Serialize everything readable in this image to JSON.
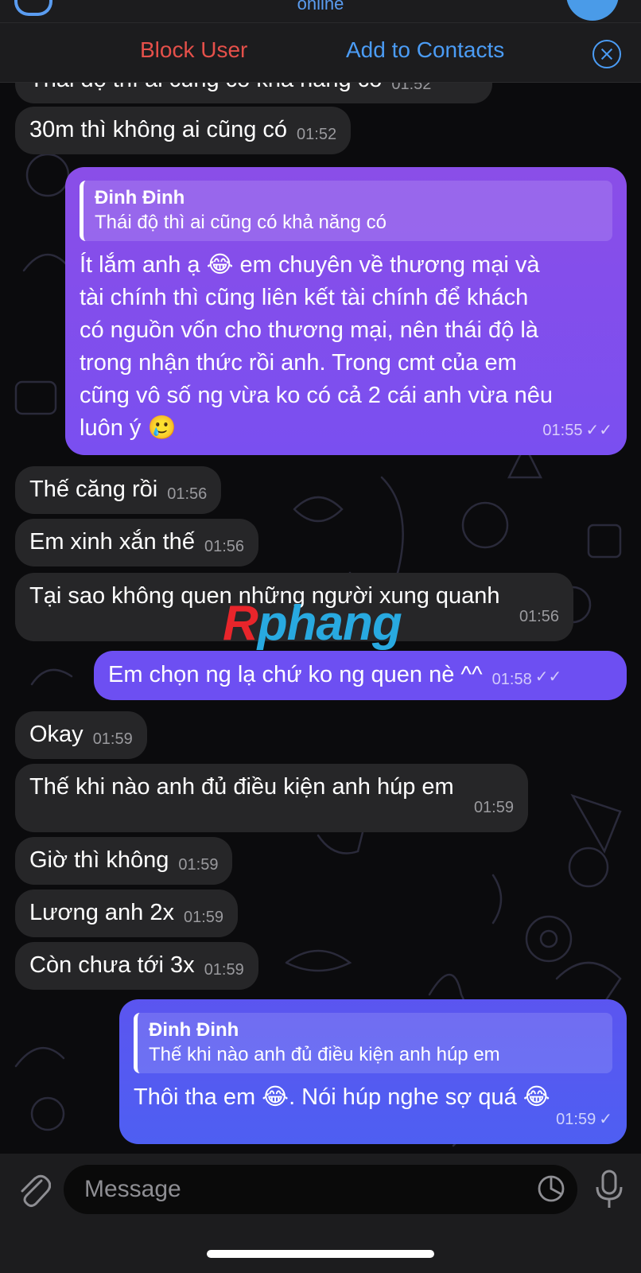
{
  "header": {
    "status": "online",
    "block_label": "Block User",
    "add_contacts_label": "Add to Contacts"
  },
  "messages": [
    {
      "dir": "in",
      "text": "Thái độ thì ai cũng có khả năng có",
      "time": "01:52"
    },
    {
      "dir": "in",
      "text": "30m thì không ai cũng có",
      "time": "01:52"
    },
    {
      "dir": "out",
      "reply_name": "Đinh Đinh",
      "reply_text": "Thái độ thì ai cũng có khả năng có",
      "lines": [
        "Ít lắm anh ạ 😂 em chuyên về thương mại và",
        "tài chính thì cũng liên kết tài chính để khách",
        "có nguồn vốn cho thương mại, nên thái độ là",
        "trong nhận thức rồi anh. Trong cmt của em",
        "cũng vô số ng vừa ko có cả 2 cái anh vừa nêu",
        "luôn ý 🥲"
      ],
      "time": "01:55",
      "status": "read"
    },
    {
      "dir": "in",
      "text": "Thế căng rồi",
      "time": "01:56"
    },
    {
      "dir": "in",
      "text": "Em xinh xắn thế",
      "time": "01:56"
    },
    {
      "dir": "in",
      "text": "Tại sao không quen những người xung quanh",
      "time": "01:56"
    },
    {
      "dir": "out",
      "text": "Em chọn ng lạ chứ ko ng quen nè ^^",
      "time": "01:58",
      "status": "read"
    },
    {
      "dir": "in",
      "text": "Okay",
      "time": "01:59"
    },
    {
      "dir": "in",
      "text": "Thế khi nào anh đủ điều kiện anh húp em",
      "time": "01:59"
    },
    {
      "dir": "in",
      "text": "Giờ thì không",
      "time": "01:59"
    },
    {
      "dir": "in",
      "text": "Lương anh 2x",
      "time": "01:59"
    },
    {
      "dir": "in",
      "text": "Còn chưa tới 3x",
      "time": "01:59"
    },
    {
      "dir": "out",
      "reply_name": "Đinh Đinh",
      "reply_text": "Thế khi nào anh đủ điều kiện anh húp em",
      "text": "Thôi tha em 😂. Nói húp nghe sợ quá 😂",
      "time": "01:59",
      "status": "sent"
    }
  ],
  "watermark": {
    "first": "R",
    "rest": "phang"
  },
  "composer": {
    "placeholder": "Message"
  },
  "icons": {
    "attach": "paperclip-icon",
    "sticker": "sticker-icon",
    "mic": "microphone-icon",
    "close": "close-circle-icon",
    "read": "double-check-icon",
    "sent": "single-check-icon"
  },
  "colors": {
    "incoming_bubble": "#262628",
    "outgoing_purple": "#8a4ee8",
    "outgoing_blue": "#5b55f0",
    "accent_blue": "#4b9cf5",
    "danger_red": "#e5504a"
  }
}
